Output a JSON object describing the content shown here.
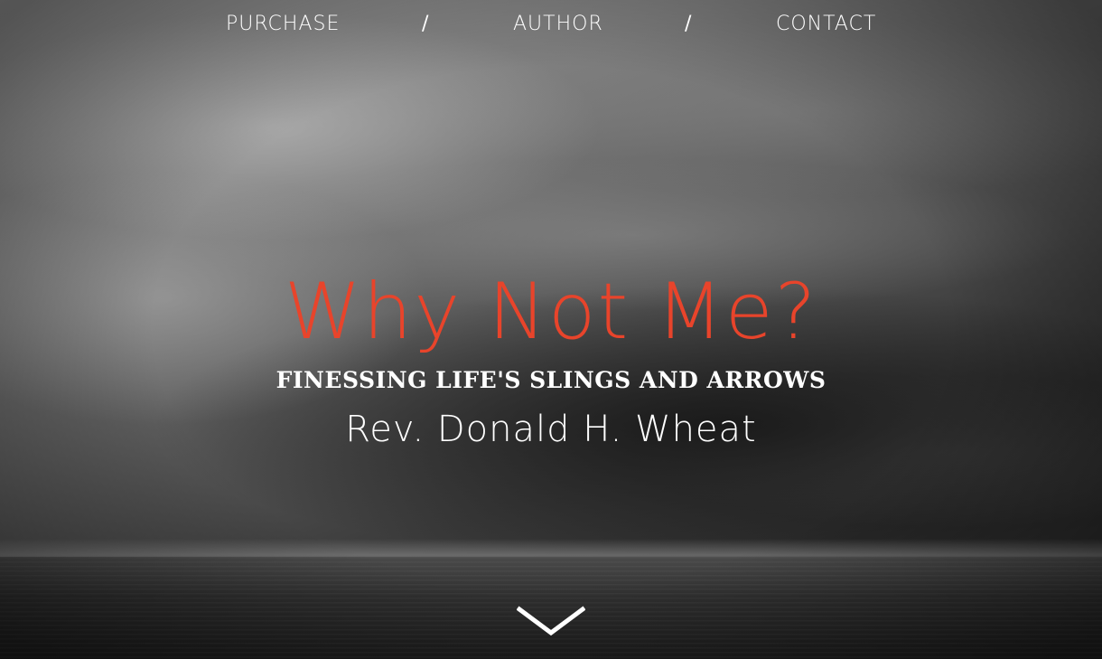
{
  "nav": {
    "items": [
      {
        "label": "PURCHASE"
      },
      {
        "label": "AUTHOR"
      },
      {
        "label": "CONTACT"
      }
    ],
    "separator": "/"
  },
  "hero": {
    "title": "Why Not Me?",
    "subtitle": "FINESSING LIFE'S SLINGS AND ARROWS",
    "author": "Rev. Donald H. Wheat",
    "scroll_icon": "chevron-down-icon",
    "title_color": "#e8442b"
  }
}
